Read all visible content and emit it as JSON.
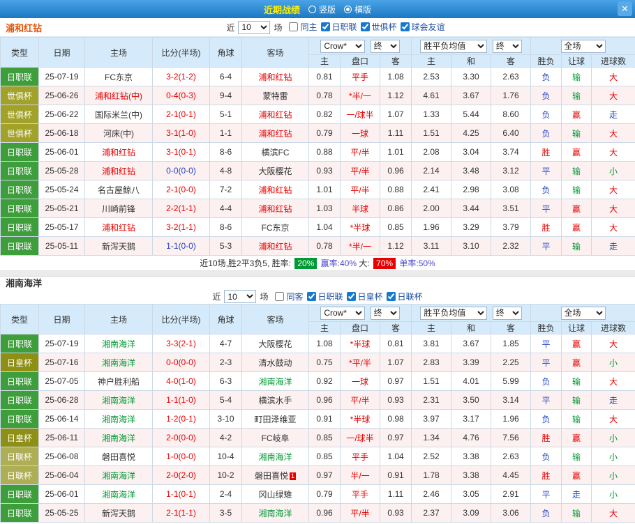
{
  "titlebar": {
    "title": "近期战绩",
    "layout_options": [
      {
        "label": "竖版",
        "selected": false
      },
      {
        "label": "横版",
        "selected": true
      }
    ],
    "close_icon": "✕"
  },
  "table_headers": {
    "type": "类型",
    "date": "日期",
    "home": "主场",
    "score": "比分(半场)",
    "corners": "角球",
    "away": "客场",
    "asian_home": "主",
    "asian_handicap": "盘口",
    "asian_away": "客",
    "europe_home": "主",
    "europe_draw": "和",
    "europe_away": "客",
    "result": "胜负",
    "handicap_result": "让球",
    "goals": "进球数"
  },
  "table_selects": {
    "bookmaker": "Crow*",
    "time": "终",
    "europe": "胜平负均值",
    "scope": "全场"
  },
  "league_colors": {
    "日职联": "#3e9e3c",
    "世俱杯": "#a2a22a",
    "日皇杯": "#8f8f16",
    "日联杯": "#aeae54"
  },
  "value_colors": {
    "胜": "red",
    "平": "blue",
    "负": "blue",
    "赢": "red",
    "输": "green",
    "走": "blue",
    "大": "red",
    "小": "green"
  },
  "sections": [
    {
      "team": "浦和红钻",
      "team_color": "#e25308",
      "focus_color": "#e60000",
      "controls": {
        "near": "近",
        "count": "10",
        "games": "场",
        "checkboxes": [
          {
            "label": "同主",
            "checked": false
          },
          {
            "label": "日职联",
            "checked": true
          },
          {
            "label": "世俱杯",
            "checked": true
          },
          {
            "label": "球会友谊",
            "checked": true
          }
        ]
      },
      "rows": [
        {
          "league": "日职联",
          "date": "25-07-19",
          "home": "FC东京",
          "home_focus": false,
          "score": "3-2(1-2)",
          "score_color": "red",
          "corners": "6-4",
          "away": "浦和红钻",
          "away_focus": true,
          "asian": [
            "0.81",
            "平手",
            "1.08"
          ],
          "europe": [
            "2.53",
            "3.30",
            "2.63"
          ],
          "result": "负",
          "let": "输",
          "goals": "大"
        },
        {
          "league": "世俱杯",
          "date": "25-06-26",
          "home": "浦和红钻(中)",
          "home_focus": true,
          "score": "0-4(0-3)",
          "score_color": "red",
          "corners": "9-4",
          "away": "蒙特雷",
          "away_focus": false,
          "asian": [
            "0.78",
            "*半/一",
            "1.12"
          ],
          "europe": [
            "4.61",
            "3.67",
            "1.76"
          ],
          "result": "负",
          "let": "输",
          "goals": "大"
        },
        {
          "league": "世俱杯",
          "date": "25-06-22",
          "home": "国际米兰(中)",
          "home_focus": false,
          "score": "2-1(0-1)",
          "score_color": "red",
          "corners": "5-1",
          "away": "浦和红钻",
          "away_focus": true,
          "asian": [
            "0.82",
            "一/球半",
            "1.07"
          ],
          "europe": [
            "1.33",
            "5.44",
            "8.60"
          ],
          "result": "负",
          "let": "赢",
          "goals": "走"
        },
        {
          "league": "世俱杯",
          "date": "25-06-18",
          "home": "河床(中)",
          "home_focus": false,
          "score": "3-1(1-0)",
          "score_color": "red",
          "corners": "1-1",
          "away": "浦和红钻",
          "away_focus": true,
          "asian": [
            "0.79",
            "一球",
            "1.11"
          ],
          "europe": [
            "1.51",
            "4.25",
            "6.40"
          ],
          "result": "负",
          "let": "输",
          "goals": "大"
        },
        {
          "league": "日职联",
          "date": "25-06-01",
          "home": "浦和红钻",
          "home_focus": true,
          "score": "3-1(0-1)",
          "score_color": "red",
          "corners": "8-6",
          "away": "横滨FC",
          "away_focus": false,
          "asian": [
            "0.88",
            "平/半",
            "1.01"
          ],
          "europe": [
            "2.08",
            "3.04",
            "3.74"
          ],
          "result": "胜",
          "let": "赢",
          "goals": "大"
        },
        {
          "league": "日职联",
          "date": "25-05-28",
          "home": "浦和红钻",
          "home_focus": true,
          "score": "0-0(0-0)",
          "score_color": "blue",
          "corners": "4-8",
          "away": "大阪樱花",
          "away_focus": false,
          "asian": [
            "0.93",
            "平/半",
            "0.96"
          ],
          "europe": [
            "2.14",
            "3.48",
            "3.12"
          ],
          "result": "平",
          "let": "输",
          "goals": "小"
        },
        {
          "league": "日职联",
          "date": "25-05-24",
          "home": "名古屋鲸八",
          "home_focus": false,
          "score": "2-1(0-0)",
          "score_color": "red",
          "corners": "7-2",
          "away": "浦和红钻",
          "away_focus": true,
          "asian": [
            "1.01",
            "平/半",
            "0.88"
          ],
          "europe": [
            "2.41",
            "2.98",
            "3.08"
          ],
          "result": "负",
          "let": "输",
          "goals": "大"
        },
        {
          "league": "日职联",
          "date": "25-05-21",
          "home": "川崎前锋",
          "home_focus": false,
          "score": "2-2(1-1)",
          "score_color": "red",
          "corners": "4-4",
          "away": "浦和红钻",
          "away_focus": true,
          "asian": [
            "1.03",
            "半球",
            "0.86"
          ],
          "europe": [
            "2.00",
            "3.44",
            "3.51"
          ],
          "result": "平",
          "let": "赢",
          "goals": "大"
        },
        {
          "league": "日职联",
          "date": "25-05-17",
          "home": "浦和红钻",
          "home_focus": true,
          "score": "3-2(1-1)",
          "score_color": "red",
          "corners": "8-6",
          "away": "FC东京",
          "away_focus": false,
          "asian": [
            "1.04",
            "*半球",
            "0.85"
          ],
          "europe": [
            "1.96",
            "3.29",
            "3.79"
          ],
          "result": "胜",
          "let": "赢",
          "goals": "大"
        },
        {
          "league": "日职联",
          "date": "25-05-11",
          "home": "新泻天鹅",
          "home_focus": false,
          "score": "1-1(0-0)",
          "score_color": "blue",
          "corners": "5-3",
          "away": "浦和红钻",
          "away_focus": true,
          "asian": [
            "0.78",
            "*半/一",
            "1.12"
          ],
          "europe": [
            "3.11",
            "3.10",
            "2.32"
          ],
          "result": "平",
          "let": "输",
          "goals": "走"
        }
      ],
      "summary": [
        {
          "text": "近10场,胜2平3负5, 胜率: ",
          "cls": "s-dark"
        },
        {
          "text": "20%",
          "cls": "badge-green"
        },
        {
          "text": " 赢率:40% ",
          "cls": "s-blue"
        },
        {
          "text": "大: ",
          "cls": "s-dark"
        },
        {
          "text": "70%",
          "cls": "badge-red"
        },
        {
          "text": " 单率:50%",
          "cls": "s-blue"
        }
      ]
    },
    {
      "team": "湘南海洋",
      "team_color": "#333333",
      "focus_color": "#009933",
      "controls": {
        "near": "近",
        "count": "10",
        "games": "场",
        "checkboxes": [
          {
            "label": "同客",
            "checked": false
          },
          {
            "label": "日职联",
            "checked": true
          },
          {
            "label": "日皇杯",
            "checked": true
          },
          {
            "label": "日联杯",
            "checked": true
          }
        ]
      },
      "rows": [
        {
          "league": "日职联",
          "date": "25-07-19",
          "home": "湘南海洋",
          "home_focus": true,
          "score": "3-3(2-1)",
          "score_color": "red",
          "corners": "4-7",
          "away": "大阪樱花",
          "away_focus": false,
          "asian": [
            "1.08",
            "*半球",
            "0.81"
          ],
          "europe": [
            "3.81",
            "3.67",
            "1.85"
          ],
          "result": "平",
          "let": "赢",
          "goals": "大"
        },
        {
          "league": "日皇杯",
          "date": "25-07-16",
          "home": "湘南海洋",
          "home_focus": true,
          "score": "0-0(0-0)",
          "score_color": "red",
          "corners": "2-3",
          "away": "清水鼓动",
          "away_focus": false,
          "asian": [
            "0.75",
            "*平/半",
            "1.07"
          ],
          "europe": [
            "2.83",
            "3.39",
            "2.25"
          ],
          "result": "平",
          "let": "赢",
          "goals": "小"
        },
        {
          "league": "日职联",
          "date": "25-07-05",
          "home": "神户胜利船",
          "home_focus": false,
          "score": "4-0(1-0)",
          "score_color": "red",
          "corners": "6-3",
          "away": "湘南海洋",
          "away_focus": true,
          "asian": [
            "0.92",
            "一球",
            "0.97"
          ],
          "europe": [
            "1.51",
            "4.01",
            "5.99"
          ],
          "result": "负",
          "let": "输",
          "goals": "大"
        },
        {
          "league": "日职联",
          "date": "25-06-28",
          "home": "湘南海洋",
          "home_focus": true,
          "score": "1-1(1-0)",
          "score_color": "red",
          "corners": "5-4",
          "away": "横滨水手",
          "away_focus": false,
          "asian": [
            "0.96",
            "平/半",
            "0.93"
          ],
          "europe": [
            "2.31",
            "3.50",
            "3.14"
          ],
          "result": "平",
          "let": "输",
          "goals": "走"
        },
        {
          "league": "日职联",
          "date": "25-06-14",
          "home": "湘南海洋",
          "home_focus": true,
          "score": "1-2(0-1)",
          "score_color": "red",
          "corners": "3-10",
          "away": "町田泽维亚",
          "away_focus": false,
          "asian": [
            "0.91",
            "*半球",
            "0.98"
          ],
          "europe": [
            "3.97",
            "3.17",
            "1.96"
          ],
          "result": "负",
          "let": "输",
          "goals": "大"
        },
        {
          "league": "日皇杯",
          "date": "25-06-11",
          "home": "湘南海洋",
          "home_focus": true,
          "score": "2-0(0-0)",
          "score_color": "red",
          "corners": "4-2",
          "away": "FC岐阜",
          "away_focus": false,
          "asian": [
            "0.85",
            "一/球半",
            "0.97"
          ],
          "europe": [
            "1.34",
            "4.76",
            "7.56"
          ],
          "result": "胜",
          "let": "赢",
          "goals": "小"
        },
        {
          "league": "日联杯",
          "date": "25-06-08",
          "home": "磐田喜悦",
          "home_focus": false,
          "score": "1-0(0-0)",
          "score_color": "red",
          "corners": "10-4",
          "away": "湘南海洋",
          "away_focus": true,
          "asian": [
            "0.85",
            "平手",
            "1.04"
          ],
          "europe": [
            "2.52",
            "3.38",
            "2.63"
          ],
          "result": "负",
          "let": "输",
          "goals": "小"
        },
        {
          "league": "日联杯",
          "date": "25-06-04",
          "home": "湘南海洋",
          "home_focus": true,
          "score": "2-0(2-0)",
          "score_color": "red",
          "corners": "10-2",
          "away": "磐田喜悦",
          "away_focus": false,
          "away_badge": "1",
          "asian": [
            "0.97",
            "半/一",
            "0.91"
          ],
          "europe": [
            "1.78",
            "3.38",
            "4.45"
          ],
          "result": "胜",
          "let": "赢",
          "goals": "小"
        },
        {
          "league": "日职联",
          "date": "25-06-01",
          "home": "湘南海洋",
          "home_focus": true,
          "score": "1-1(0-1)",
          "score_color": "red",
          "corners": "2-4",
          "away": "冈山绿雉",
          "away_focus": false,
          "asian": [
            "0.79",
            "平手",
            "1.11"
          ],
          "europe": [
            "2.46",
            "3.05",
            "2.91"
          ],
          "result": "平",
          "let": "走",
          "goals": "小"
        },
        {
          "league": "日职联",
          "date": "25-05-25",
          "home": "新泻天鹅",
          "home_focus": false,
          "score": "2-1(1-1)",
          "score_color": "red",
          "corners": "3-5",
          "away": "湘南海洋",
          "away_focus": true,
          "asian": [
            "0.96",
            "平/半",
            "0.93"
          ],
          "europe": [
            "2.37",
            "3.09",
            "3.06"
          ],
          "result": "负",
          "let": "输",
          "goals": "大"
        }
      ]
    }
  ]
}
